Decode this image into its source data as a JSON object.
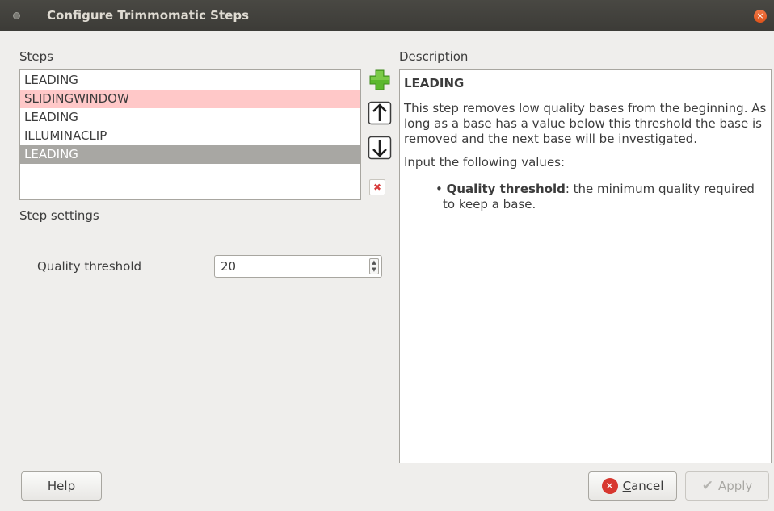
{
  "window": {
    "title": "Configure Trimmomatic Steps",
    "close_glyph": "×"
  },
  "steps": {
    "label": "Steps",
    "items": [
      {
        "label": "LEADING",
        "state": "normal"
      },
      {
        "label": "SLIDINGWINDOW",
        "state": "error"
      },
      {
        "label": "LEADING",
        "state": "normal"
      },
      {
        "label": "ILLUMINACLIP",
        "state": "normal"
      },
      {
        "label": "LEADING",
        "state": "selected"
      }
    ],
    "icons": {
      "add": "add-icon",
      "up": "arrow-up-icon",
      "down": "arrow-down-icon",
      "remove": "remove-icon"
    },
    "remove_glyph": "✖"
  },
  "step_settings": {
    "label": "Step settings",
    "quality_label": "Quality threshold",
    "quality_value": "20",
    "spin_up": "▲",
    "spin_down": "▼"
  },
  "description": {
    "label": "Description",
    "title": "LEADING",
    "body": "This step removes low quality bases from the beginning. As long as a base has a value below this threshold the base is removed and the next base will be investigated.",
    "input_intro": "Input the following values:",
    "bullet_term": "Quality threshold",
    "bullet_text": ": the minimum quality required to keep a base."
  },
  "buttons": {
    "help": "Help",
    "cancel": "Cancel",
    "apply": "Apply",
    "cancel_glyph": "✕",
    "apply_glyph": "✔"
  },
  "colors": {
    "titlebar": "#3c3b37",
    "error_row": "#ffc8c8",
    "selected_row": "#a8a7a3",
    "close_button": "#e0531a",
    "cancel_icon": "#d7372f",
    "add_icon": "#5cb82e"
  }
}
